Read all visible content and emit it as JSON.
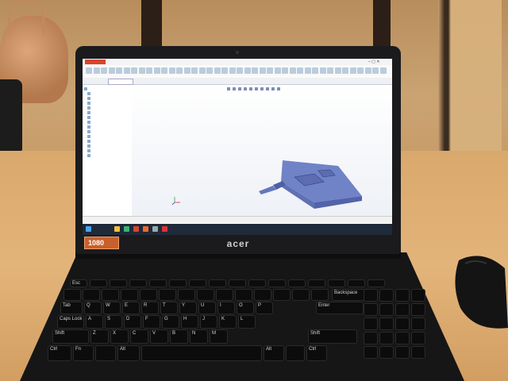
{
  "app": {
    "window_title": "",
    "window_controls": "– ▢ ✕"
  },
  "tabs": [
    "",
    "",
    "",
    "",
    "",
    "",
    "",
    "",
    "",
    "",
    ""
  ],
  "tree": [
    "",
    "",
    "",
    "",
    "",
    "",
    "",
    "",
    "",
    "",
    "",
    "",
    "",
    "",
    ""
  ],
  "bottom_tabs": [
    "",
    "",
    ""
  ],
  "taskbar": {
    "time": "",
    "date": ""
  },
  "laptop": {
    "brand": "acer",
    "sticker": "1080"
  },
  "keyboard": {
    "row_labels": [
      "Esc",
      "Tab",
      "Caps Lock",
      "Shift",
      "Ctrl",
      "Fn",
      "Alt",
      "Alt",
      "Ctrl",
      "Enter",
      "Shift",
      "Backspace"
    ],
    "letters_row1": [
      "Q",
      "W",
      "E",
      "R",
      "T",
      "Y",
      "U",
      "I",
      "O",
      "P"
    ],
    "letters_row2": [
      "A",
      "S",
      "D",
      "F",
      "G",
      "H",
      "J",
      "K",
      "L"
    ],
    "letters_row3": [
      "Z",
      "X",
      "C",
      "V",
      "B",
      "N",
      "M"
    ]
  },
  "colors": {
    "accent": "#d9452b",
    "model_face": "#6f83c8",
    "model_side": "#5062a8",
    "taskbar": "#1f2a3a"
  }
}
